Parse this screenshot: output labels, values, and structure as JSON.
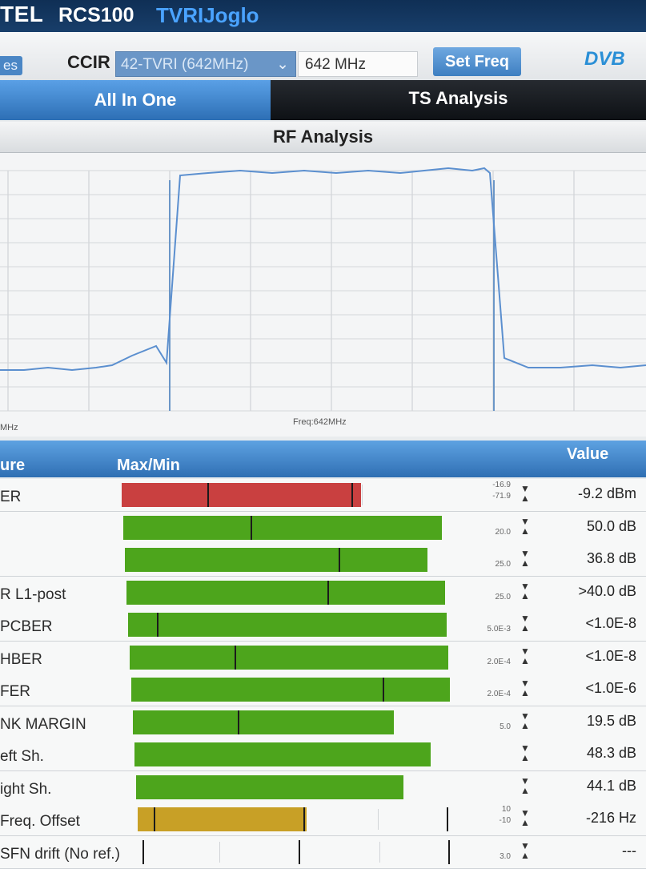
{
  "header": {
    "brand": "TEL",
    "model": "RCS100",
    "station": "TVRIJoglo"
  },
  "toolbar": {
    "left_button": "es",
    "standard_label": "CCIR",
    "channel_select": "42-TVRI (642MHz)",
    "frequency_value": "642 MHz",
    "set_freq_label": "Set Freq",
    "logo_text": "DVB"
  },
  "tabs": [
    {
      "label": "All In One",
      "active": true
    },
    {
      "label": "TS Analysis",
      "active": false
    }
  ],
  "rf": {
    "title": "RF Analysis",
    "left_axis_label": "MHz",
    "freq_label": "Freq:642MHz",
    "chart_data": {
      "type": "line",
      "title": "RF Analysis",
      "xlabel": "Freq:642MHz",
      "series": [
        {
          "values": [
            0.12,
            0.12,
            0.13,
            0.12,
            0.13,
            0.14,
            0.18,
            0.22,
            0.15,
            0.93,
            0.94,
            0.95,
            0.94,
            0.95,
            0.94,
            0.95,
            0.94,
            0.95,
            0.96,
            0.95,
            0.96,
            0.94,
            0.17,
            0.13,
            0.13,
            0.14,
            0.13,
            0.14
          ]
        }
      ]
    }
  },
  "table": {
    "headers": {
      "measure": "ure",
      "maxmin": "Max/Min",
      "value": "Value"
    },
    "rows": [
      {
        "label": "ER",
        "fill": 0.75,
        "color": "#c94040",
        "marker": 0.27,
        "marker2": 0.72,
        "thresh": "-16.9",
        "thresh2": "-71.9",
        "value": "-9.2 dBm"
      },
      {
        "label": "",
        "fill": 1.0,
        "color": "#4da51c",
        "marker": 0.4,
        "thresh": "20.0",
        "value": "50.0 dB"
      },
      {
        "label": "",
        "fill": 0.95,
        "color": "#4da51c",
        "marker": 0.67,
        "thresh": "25.0",
        "value": "36.8 dB"
      },
      {
        "label": "R L1-post",
        "fill": 1.0,
        "color": "#4da51c",
        "marker": 0.63,
        "thresh": "25.0",
        "value": ">40.0 dB"
      },
      {
        "label": "PCBER",
        "fill": 1.0,
        "color": "#4da51c",
        "marker": 0.09,
        "thresh": "5.0E-3",
        "value": "<1.0E-8"
      },
      {
        "label": "HBER",
        "fill": 1.0,
        "color": "#4da51c",
        "marker": 0.33,
        "thresh": "2.0E-4",
        "value": "<1.0E-8"
      },
      {
        "label": "FER",
        "fill": 1.0,
        "color": "#4da51c",
        "marker": 0.79,
        "thresh": "2.0E-4",
        "value": "<1.0E-6"
      },
      {
        "label": "NK MARGIN",
        "fill": 0.82,
        "color": "#4da51c",
        "marker": 0.33,
        "thresh": "5.0",
        "value": "19.5 dB"
      },
      {
        "label": "eft Sh.",
        "fill": 0.93,
        "color": "#4da51c",
        "thresh": "",
        "value": "48.3 dB"
      },
      {
        "label": "ight Sh.",
        "fill": 0.84,
        "color": "#4da51c",
        "thresh": "",
        "value": "44.1 dB"
      },
      {
        "label": "Freq. Offset",
        "fill": 0.53,
        "color": "#c8a026",
        "marker": 0.05,
        "marker2": 0.52,
        "marker3": 0.97,
        "thresh": "10",
        "thresh2": "-10",
        "value": "-216 Hz"
      },
      {
        "label": "SFN drift (No ref.)",
        "fill": 0.0,
        "color": "#4da51c",
        "marker": 0.01,
        "marker2": 0.5,
        "marker3": 0.97,
        "thresh": "3.0",
        "value": "---"
      }
    ]
  }
}
